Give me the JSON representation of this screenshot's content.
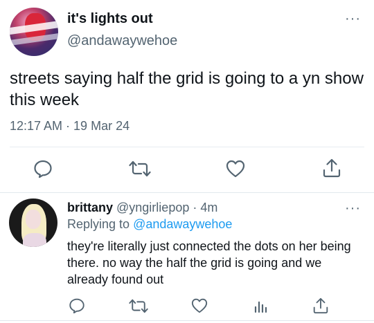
{
  "tweet": {
    "display_name": "it's lights out",
    "handle": "@andawaywehoe",
    "more": "···",
    "text": "streets saying half the grid is going to a yn show this week",
    "timestamp": "12:17 AM · 19 Mar 24",
    "actions": [
      "reply-icon",
      "retweet-icon",
      "like-icon",
      "share-icon"
    ]
  },
  "reply": {
    "display_name": "brittany",
    "meta": " @yngirliepop · 4m",
    "replying_prefix": "Replying to ",
    "replying_to": "@andawaywehoe",
    "more": "···",
    "text": "they're literally just connected the dots on her being there. no way the half the grid is going and we already found out",
    "actions": [
      "reply-icon",
      "retweet-icon",
      "like-icon",
      "views-icon",
      "share-icon"
    ]
  },
  "colors": {
    "text": "#0f1419",
    "secondary": "#536471",
    "link": "#1d9bf0",
    "divider": "#e1e8ed"
  }
}
